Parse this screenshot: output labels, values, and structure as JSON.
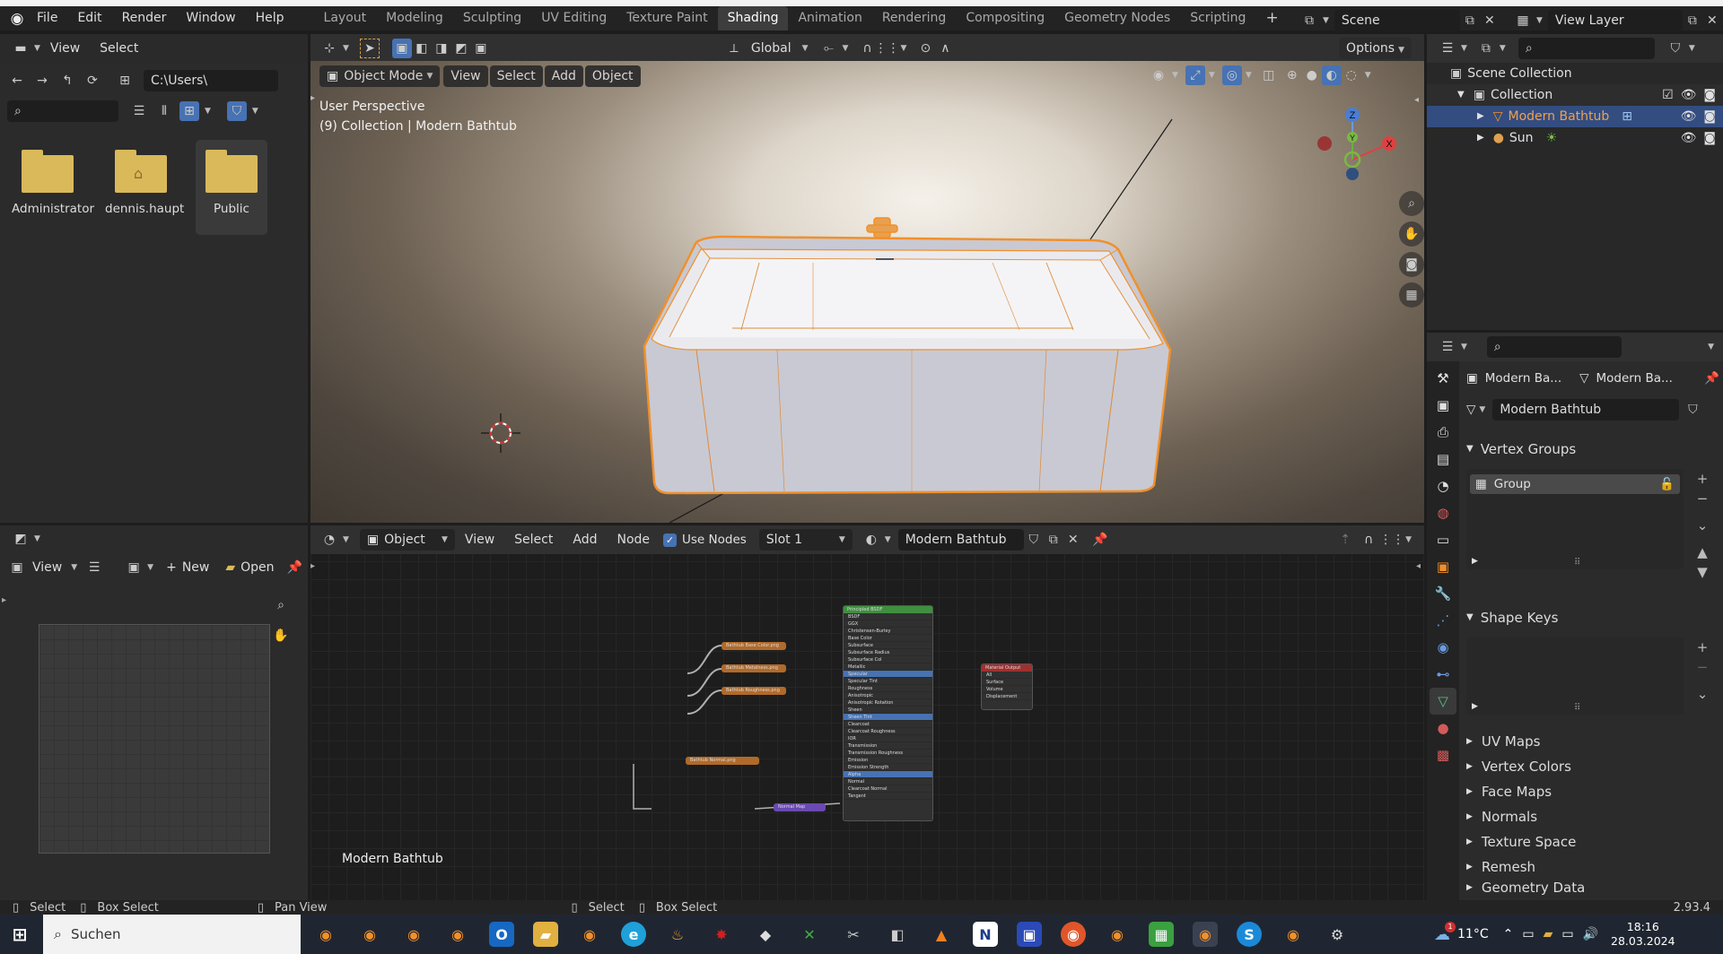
{
  "menubar": {
    "menus": [
      "File",
      "Edit",
      "Render",
      "Window",
      "Help"
    ],
    "workspaces": [
      "Layout",
      "Modeling",
      "Sculpting",
      "UV Editing",
      "Texture Paint",
      "Shading",
      "Animation",
      "Rendering",
      "Compositing",
      "Geometry Nodes",
      "Scripting"
    ],
    "active_workspace": "Shading",
    "add_tab": "+",
    "scene_label": "Scene",
    "view_layer_label": "View Layer"
  },
  "file_browser": {
    "menu_view": "View",
    "menu_select": "Select",
    "path": "C:\\Users\\",
    "search_placeholder": "",
    "folders": [
      "Administrator",
      "dennis.haupt",
      "Public"
    ]
  },
  "image_editor": {
    "view": "View",
    "new": "New",
    "open": "Open"
  },
  "viewport": {
    "orientation": "Global",
    "options": "Options",
    "mode": "Object Mode",
    "menus": [
      "View",
      "Select",
      "Add",
      "Object"
    ],
    "perspective": "User Perspective",
    "collection_info": "(9) Collection | Modern Bathtub",
    "axis_x": "X",
    "axis_y": "Y",
    "axis_z": "Z"
  },
  "node_editor": {
    "object_type": "Object",
    "menus": [
      "View",
      "Select",
      "Add",
      "Node"
    ],
    "use_nodes": "Use Nodes",
    "slot": "Slot 1",
    "material": "Modern Bathtub",
    "material_label": "Modern Bathtub",
    "nodes": {
      "principled": "Principled BSDF",
      "output": "Material Output",
      "base_color": "Bathtub Base Color.png",
      "metalness": "Bathtub Metalness.png",
      "roughness": "Bathtub Roughness.png",
      "normal_img": "Bathtub Normal.png",
      "normal_map": "Normal Map",
      "principled_rows": [
        "BSDF",
        "GGX",
        "Christensen-Burley",
        "Base Color",
        "Subsurface",
        "Subsurface Radius",
        "Subsurface Col",
        "Metallic",
        "Specular",
        "Specular Tint",
        "Roughness",
        "Anisotropic",
        "Anisotropic Rotation",
        "Sheen",
        "Sheen Tint",
        "Clearcoat",
        "Clearcoat Roughness",
        "IOR",
        "Transmission",
        "Transmission Roughness",
        "Emission",
        "Emission Strength",
        "Alpha",
        "Normal",
        "Clearcoat Normal",
        "Tangent"
      ],
      "output_rows": [
        "All",
        "Surface",
        "Volume",
        "Displacement"
      ]
    }
  },
  "outliner": {
    "root": "Scene Collection",
    "collection": "Collection",
    "items": [
      "Modern Bathtub",
      "Sun"
    ]
  },
  "properties": {
    "breadcrumb_object": "Modern Ba...",
    "breadcrumb_mesh": "Modern Ba...",
    "mesh_name": "Modern Bathtub",
    "vertex_groups": "Vertex Groups",
    "group_item": "Group",
    "shape_keys": "Shape Keys",
    "collapsed_panels": [
      "UV Maps",
      "Vertex Colors",
      "Face Maps",
      "Normals",
      "Texture Space",
      "Remesh",
      "Geometry Data"
    ]
  },
  "statusbar": {
    "left_select": "Select",
    "left_box": "Box Select",
    "pan": "Pan View",
    "right_select": "Select",
    "right_box": "Box Select",
    "version": "2.93.4"
  },
  "taskbar": {
    "search": "Suchen",
    "temperature": "11°C",
    "time": "18:16",
    "date": "28.03.2024",
    "weather_badge": "1"
  },
  "colors": {
    "accent_blue": "#4772b3",
    "selection_orange": "#f0902b",
    "folder": "#d9b95a"
  }
}
